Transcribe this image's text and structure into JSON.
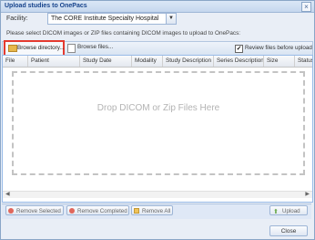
{
  "window": {
    "title": "Upload studies to OnePacs"
  },
  "facility": {
    "label": "Facility:",
    "selected": "The CORE Institute Specialty Hospital"
  },
  "instruction": "Please select DICOM images or ZIP files containing DICOM images to upload to OnePacs:",
  "toolbar": {
    "browse_directory": "Browse directory...",
    "browse_files": "Browse files...",
    "review_checked": true,
    "review_label": "Review files before upload"
  },
  "grid": {
    "columns": [
      "File",
      "Patient",
      "Study Date",
      "Modality",
      "Study Description",
      "Series Description",
      "Size",
      "Status"
    ],
    "drop_text": "Drop DICOM or Zip Files Here"
  },
  "actions": {
    "remove_selected": "Remove Selected",
    "remove_completed": "Remove Completed",
    "remove_all": "Remove All",
    "upload": "Upload"
  },
  "footer": {
    "close": "Close"
  },
  "colors": {
    "highlight_border": "#e53a2f",
    "title_text": "#15428b"
  },
  "icons": [
    "close-icon",
    "folder-icon",
    "file-icon",
    "checkbox-icon",
    "remove-icon",
    "remove-all-icon",
    "upload-icon",
    "scroll-left-icon",
    "scroll-right-icon",
    "dropdown-arrow-icon"
  ]
}
